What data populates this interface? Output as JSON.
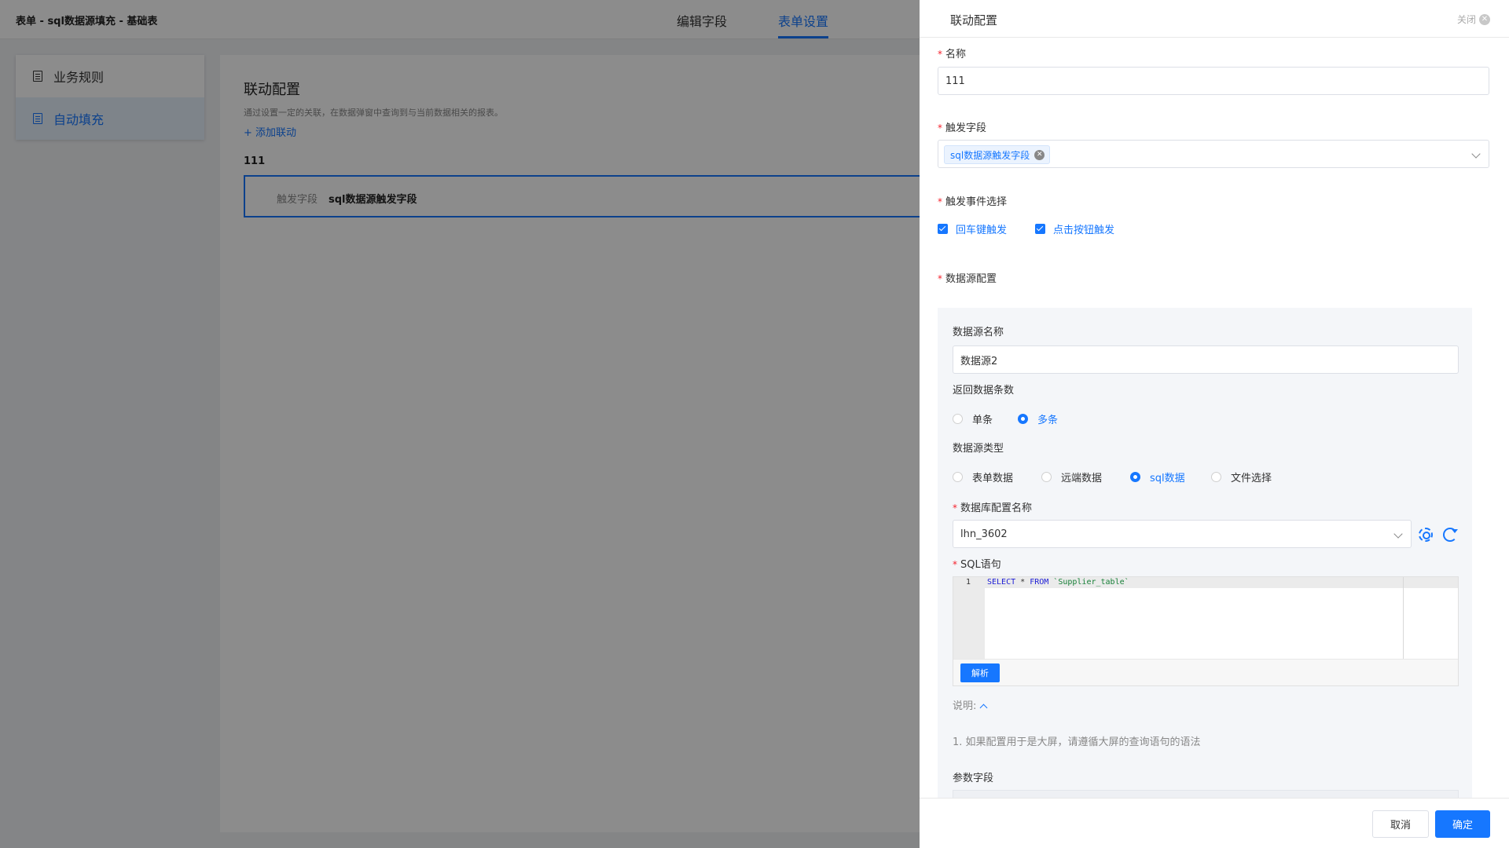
{
  "app": {
    "title": "表单 - sql数据源填充 - 基础表",
    "tabs": [
      {
        "label": "编辑字段",
        "active": false
      },
      {
        "label": "表单设置",
        "active": true
      }
    ]
  },
  "sidebar": {
    "items": [
      {
        "label": "业务规则",
        "icon": "document-icon",
        "active": false
      },
      {
        "label": "自动填充",
        "icon": "document-icon",
        "active": true
      }
    ]
  },
  "main": {
    "title": "联动配置",
    "description": "通过设置一定的关联，在数据弹窗中查询到与当前数据相关的报表。",
    "add_link": "+ 添加联动",
    "rule_name": "111",
    "rule_card": {
      "key": "触发字段",
      "value": "sql数据源触发字段"
    }
  },
  "drawer": {
    "title": "联动配置",
    "close_label": "关闭",
    "name_label": "名称",
    "name_value": "111",
    "trigger_field_label": "触发字段",
    "trigger_field_tag": "sql数据源触发字段",
    "trigger_event_label": "触发事件选择",
    "trigger_events": [
      {
        "label": "回车键触发",
        "checked": true
      },
      {
        "label": "点击按钮触发",
        "checked": true
      }
    ],
    "datasource_config_label": "数据源配置",
    "datasource": {
      "name_label": "数据源名称",
      "name_value": "数据源2",
      "return_count_label": "返回数据条数",
      "return_count_options": [
        {
          "label": "单条",
          "selected": false
        },
        {
          "label": "多条",
          "selected": true
        }
      ],
      "type_label": "数据源类型",
      "type_options": [
        {
          "label": "表单数据",
          "selected": false
        },
        {
          "label": "远端数据",
          "selected": false
        },
        {
          "label": "sql数据",
          "selected": true
        },
        {
          "label": "文件选择",
          "selected": false
        }
      ],
      "db_config_label": "数据库配置名称",
      "db_config_value": "lhn_3602",
      "sql_label": "SQL语句",
      "sql_line_number": "1",
      "sql_keyword_1": "SELECT",
      "sql_star": " * ",
      "sql_keyword_2": "FROM",
      "sql_table": " `Supplier_table`",
      "parse_button": "解析",
      "note_label": "说明:",
      "note_text": "1. 如果配置用于是大屏，请遵循大屏的查询语句的语法",
      "params_label": "参数字段"
    },
    "cancel_button": "取消",
    "confirm_button": "确定"
  },
  "colors": {
    "primary": "#1677ff",
    "required": "#f5222d",
    "overlay": "rgba(0,0,0,0.45)"
  }
}
